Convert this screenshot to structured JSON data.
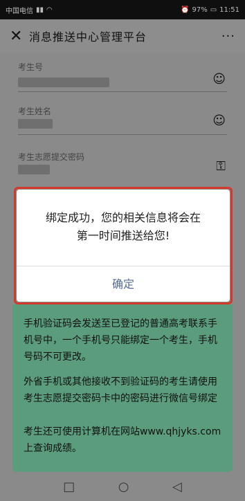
{
  "status_bar": {
    "carrier": "中国电信",
    "time": "11:51",
    "battery": "97%"
  },
  "header": {
    "title": "消息推送中心管理平台",
    "more": "···"
  },
  "form": {
    "exam_no_label": "考生号",
    "name_label": "考生姓名",
    "password_label": "考生志愿提交密码"
  },
  "dialog": {
    "message_line1": "绑定成功，您的相关信息将会在",
    "message_line2": "第一时间推送给您!",
    "confirm": "确定"
  },
  "info": {
    "p1": "手机验证码会发送至已登记的普通高考联系手机号中，一个手机号只能绑定一个考生，手机号码不可更改。",
    "p2": "外省手机或其他接收不到验证码的考生请使用考生志愿提交密码卡中的密码进行微信号绑定",
    "p3": "考生还可使用计算机在网站www.qhjyks.com上查询成绩。"
  }
}
